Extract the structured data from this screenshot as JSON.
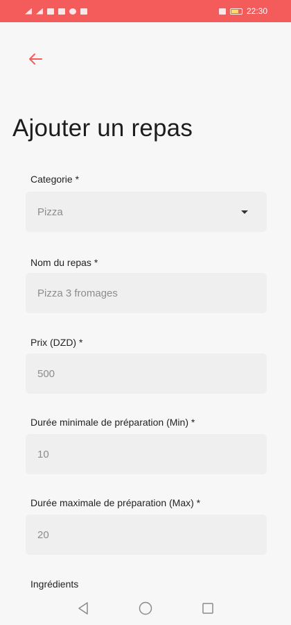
{
  "status_bar": {
    "time": "22:30"
  },
  "header": {
    "title": "Ajouter un repas"
  },
  "form": {
    "category": {
      "label": "Categorie *",
      "value": "Pizza"
    },
    "meal_name": {
      "label": "Nom du repas *",
      "value": "Pizza 3 fromages"
    },
    "price": {
      "label": "Prix (DZD) *",
      "value": "500"
    },
    "min_prep": {
      "label": "Durée minimale de préparation (Min) *",
      "value": "10"
    },
    "max_prep": {
      "label": "Durée maximale de préparation (Max) *",
      "value": "20"
    },
    "ingredients": {
      "label": "Ingrédients"
    }
  },
  "colors": {
    "accent": "#f45b5b",
    "field_bg": "#efefef",
    "page_bg": "#f7f7f7"
  },
  "icons": [
    "back-arrow-icon",
    "dropdown-caret-icon",
    "nav-back-icon",
    "nav-home-icon",
    "nav-recents-icon"
  ]
}
